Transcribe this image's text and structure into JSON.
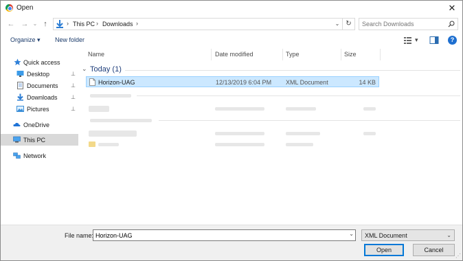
{
  "window": {
    "title": "Open",
    "close_glyph": "✕"
  },
  "nav": {
    "back": "←",
    "forward": "→",
    "up": "↑"
  },
  "address": {
    "breadcrumbs": [
      "This PC",
      "Downloads"
    ],
    "separator": "›",
    "dropdown": "⌄",
    "refresh": "↻"
  },
  "search": {
    "placeholder": "Search Downloads"
  },
  "toolbar": {
    "organize_label": "Organize",
    "organize_arrow": "▾",
    "new_folder_label": "New folder",
    "view_arrow": "▾",
    "help_label": "?"
  },
  "sidebar": {
    "items": [
      {
        "label": "Quick access",
        "icon": "star-icon"
      },
      {
        "label": "Desktop",
        "icon": "desktop-icon",
        "pinned": true
      },
      {
        "label": "Documents",
        "icon": "documents-icon",
        "pinned": true
      },
      {
        "label": "Downloads",
        "icon": "download-icon",
        "pinned": true
      },
      {
        "label": "Pictures",
        "icon": "pictures-icon",
        "pinned": true
      },
      {
        "label": "OneDrive",
        "icon": "cloud-icon"
      },
      {
        "label": "This PC",
        "icon": "computer-icon",
        "selected": true
      },
      {
        "label": "Network",
        "icon": "network-icon"
      }
    ],
    "pin_glyph": "📌"
  },
  "columns": {
    "name": "Name",
    "date": "Date modified",
    "type": "Type",
    "size": "Size"
  },
  "groups": [
    {
      "label": "Today (1)",
      "expanded_glyph": "⌄"
    }
  ],
  "files": [
    {
      "name": "Horizon-UAG",
      "date": "12/13/2019 6:04 PM",
      "type": "XML Document",
      "size": "14 KB",
      "selected": true
    }
  ],
  "footer": {
    "filename_label": "File name:",
    "filename_value": "Horizon-UAG",
    "filetype_value": "XML Document",
    "open_label": "Open",
    "cancel_label": "Cancel",
    "drop_glyph": "⌄"
  },
  "colors": {
    "accent": "#0078d7",
    "selection": "#cce8ff",
    "sidebar_selected": "#d9d9d9"
  }
}
